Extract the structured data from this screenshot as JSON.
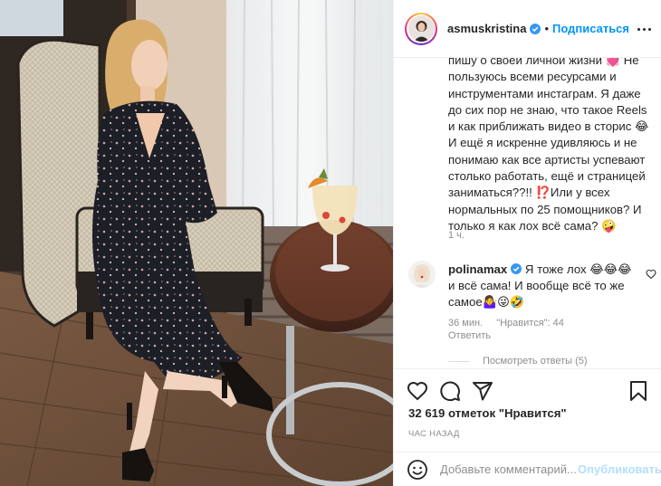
{
  "header": {
    "username": "asmuskristina",
    "separator": "•",
    "follow_label": "Подписаться"
  },
  "caption": {
    "text": "пишу о своей личной жизни 💓 Не пользуюсь всеми ресурсами и инструментами инстаграм. Я даже до сих пор не знаю, что такое Reels и как приближать видео в сторис 😂 И ещё я искренне удивляюсь и не понимаю как все артисты успевают столько работать, ещё и страницей заниматься??!! ⁉️Или у всех нормальных по 25 помощников? И только я как лох всё сама? 🤪",
    "time": "1 ч."
  },
  "reply": {
    "username": "polinamax",
    "text": " Я тоже лох 😂😂😂 и всё сама! И вообще всё то же самое🤷‍♀️😜🤣",
    "time": "36 мин.",
    "likes": "\"Нравится\": 44",
    "reply_label": "Ответить",
    "view_replies": "Посмотреть ответы (5)"
  },
  "likes_text": "32 619 отметок \"Нравится\"",
  "time_ago": "ЧАС НАЗАД",
  "comment": {
    "placeholder": "Добавьте комментарий...",
    "publish_label": "Опубликовать"
  },
  "colors": {
    "accent": "#0095f6",
    "publish_disabled": "#b2dffc",
    "muted": "#8e8e8e",
    "border": "#efefef"
  },
  "icons": [
    "heart-icon",
    "comment-icon",
    "share-icon",
    "bookmark-icon",
    "emoji-icon",
    "verified-icon",
    "more-icon"
  ]
}
